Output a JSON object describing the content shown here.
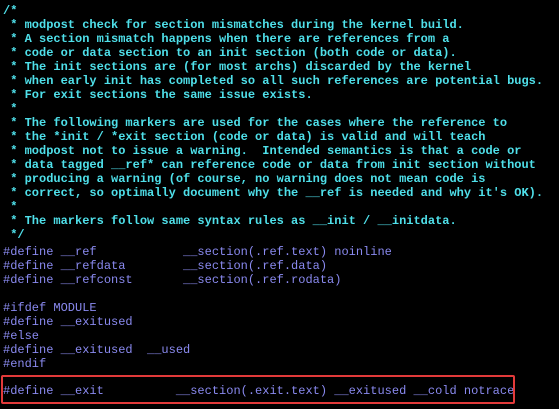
{
  "colors": {
    "background": "#000000",
    "comment": "#4fe0ea",
    "preproc": "#8a8af0",
    "highlight_border": "#e23a3a"
  },
  "editor": {
    "lines": [
      {
        "kind": "comment",
        "text": "/*"
      },
      {
        "kind": "comment",
        "text": " * modpost check for section mismatches during the kernel build."
      },
      {
        "kind": "comment",
        "text": " * A section mismatch happens when there are references from a"
      },
      {
        "kind": "comment",
        "text": " * code or data section to an init section (both code or data)."
      },
      {
        "kind": "comment",
        "text": " * The init sections are (for most archs) discarded by the kernel"
      },
      {
        "kind": "comment",
        "text": " * when early init has completed so all such references are potential bugs."
      },
      {
        "kind": "comment",
        "text": " * For exit sections the same issue exists."
      },
      {
        "kind": "comment",
        "text": " *"
      },
      {
        "kind": "comment",
        "text": " * The following markers are used for the cases where the reference to"
      },
      {
        "kind": "comment",
        "text": " * the *init / *exit section (code or data) is valid and will teach"
      },
      {
        "kind": "comment",
        "text": " * modpost not to issue a warning.  Intended semantics is that a code or"
      },
      {
        "kind": "comment",
        "text": " * data tagged __ref* can reference code or data from init section without"
      },
      {
        "kind": "comment",
        "text": " * producing a warning (of course, no warning does not mean code is"
      },
      {
        "kind": "comment",
        "text": " * correct, so optimally document why the __ref is needed and why it's OK)."
      },
      {
        "kind": "comment",
        "text": " *"
      },
      {
        "kind": "comment",
        "text": " * The markers follow same syntax rules as __init / __initdata."
      },
      {
        "kind": "comment",
        "text": " */"
      },
      {
        "kind": "preproc",
        "text": "#define __ref            __section(.ref.text) noinline"
      },
      {
        "kind": "preproc",
        "text": "#define __refdata        __section(.ref.data)"
      },
      {
        "kind": "preproc",
        "text": "#define __refconst       __section(.ref.rodata)"
      },
      {
        "kind": "blank",
        "text": ""
      },
      {
        "kind": "preproc",
        "text": "#ifdef MODULE"
      },
      {
        "kind": "preproc",
        "text": "#define __exitused"
      },
      {
        "kind": "preproc",
        "text": "#else"
      },
      {
        "kind": "preproc",
        "text": "#define __exitused  __used"
      },
      {
        "kind": "preproc",
        "text": "#endif"
      },
      {
        "kind": "blank",
        "text": ""
      },
      {
        "kind": "preproc",
        "text": "#define __exit          __section(.exit.text) __exitused __cold notrace"
      }
    ]
  }
}
